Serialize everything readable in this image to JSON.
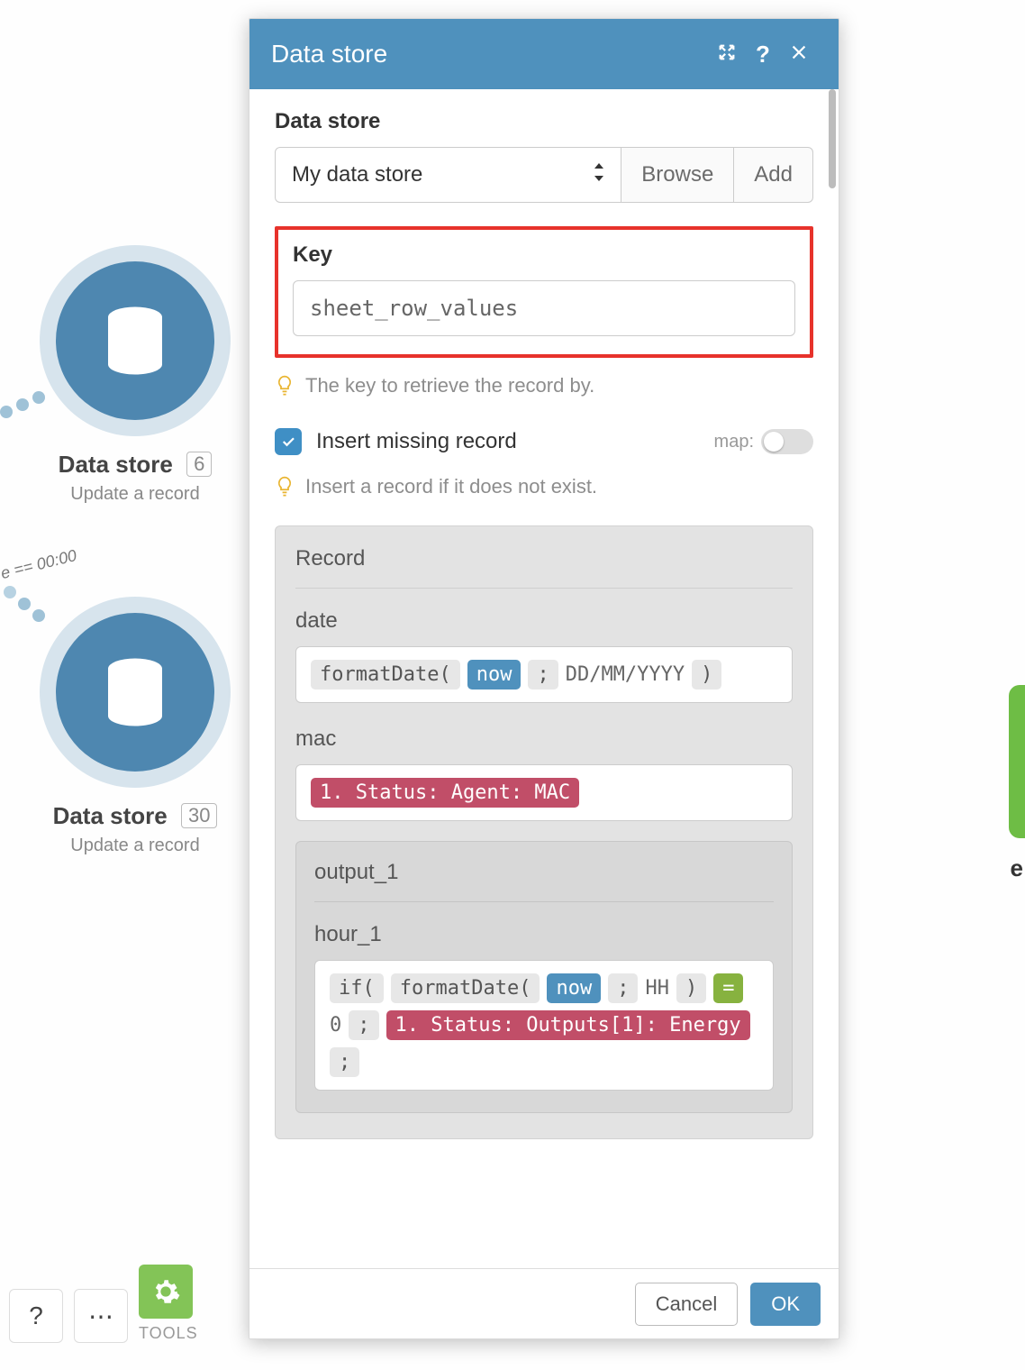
{
  "dialog": {
    "title": "Data store",
    "data_store_label": "Data store",
    "data_store_value": "My data store",
    "browse_label": "Browse",
    "add_label": "Add",
    "key_label": "Key",
    "key_value": "sheet_row_values",
    "key_hint": "The key to retrieve the record by.",
    "insert_label": "Insert missing record",
    "insert_checked": true,
    "map_label": "map:",
    "insert_hint": "Insert a record if it does not exist.",
    "record_label": "Record",
    "date_label": "date",
    "date_expr": {
      "fn_open": "formatDate(",
      "kw": "now",
      "semi": ";",
      "fmt": "DD/MM/YYYY",
      "fn_close": ")"
    },
    "mac_label": "mac",
    "mac_pill": "1. Status: Agent: MAC",
    "output1_label": "output_1",
    "hour1_label": "hour_1",
    "hour1_expr": {
      "if_open": "if(",
      "fd_open": "formatDate(",
      "kw": "now",
      "semi1": ";",
      "hh": "HH",
      "fd_close": ")",
      "eq": "=",
      "zero": "0",
      "semi2": ";",
      "pill": "1. Status: Outputs[1]: Energy",
      "semi3": ";"
    },
    "cancel": "Cancel",
    "ok": "OK"
  },
  "canvas": {
    "node1_title": "Data store",
    "node1_badge": "6",
    "node1_sub": "Update a record",
    "node2_title": "Data store",
    "node2_badge": "30",
    "node2_sub": "Update a record",
    "filter_text": "e == 00:00",
    "side_letter": "e",
    "tools_label": "TOOLS"
  }
}
